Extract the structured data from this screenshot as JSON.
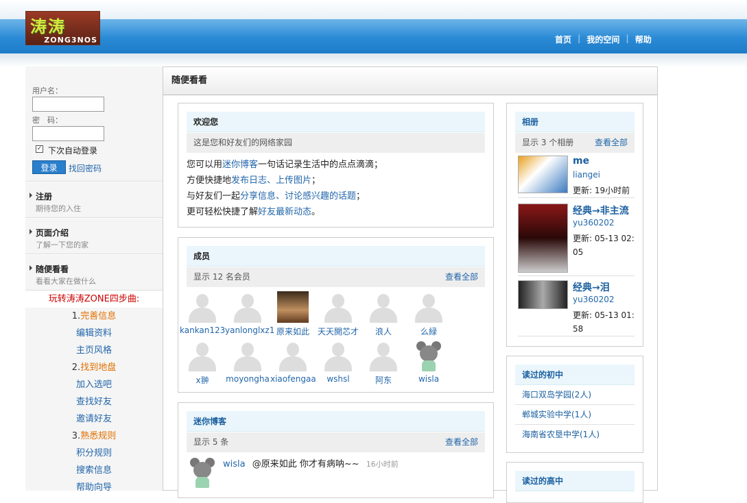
{
  "header": {
    "logo_big": "涛涛",
    "logo_small": "ZONG3NOS",
    "nav": [
      "首页",
      "我的空间",
      "帮助"
    ]
  },
  "login": {
    "username_label": "用户名：",
    "password_label": "密　码：",
    "remember_label": "下次自动登录",
    "remember_checked": true,
    "login_button": "登录",
    "forgot_link": "找回密码"
  },
  "sidebar": {
    "items": [
      {
        "title": "注册",
        "sub": "期待您的入住"
      },
      {
        "title": "页面介绍",
        "sub": "了解一下您的家"
      },
      {
        "title": "随便看看",
        "sub": "看看大家在做什么"
      }
    ],
    "steps_title": "玩转涛涛ZONE四步曲:",
    "steps": [
      {
        "num": "1.",
        "label": "完善信息",
        "kind": "heading"
      },
      {
        "label": "编辑资料",
        "kind": "link"
      },
      {
        "label": "主页风格",
        "kind": "link"
      },
      {
        "num": "2.",
        "label": "找到地盘",
        "kind": "heading"
      },
      {
        "label": "加入选吧",
        "kind": "link"
      },
      {
        "label": "查找好友",
        "kind": "link"
      },
      {
        "label": "邀请好友",
        "kind": "link"
      },
      {
        "num": "3.",
        "label": "熟悉规则",
        "kind": "heading"
      },
      {
        "label": "积分规则",
        "kind": "link"
      },
      {
        "label": "搜索信息",
        "kind": "link"
      },
      {
        "label": "帮助向导",
        "kind": "link"
      }
    ]
  },
  "main": {
    "title": "随便看看",
    "welcome": {
      "title": "欢迎您",
      "sub": "这是您和好友们的网络家园",
      "lines": [
        [
          "您可以用",
          "迷你博客",
          "一句话记录生活中的点点滴滴；"
        ],
        [
          "方便快捷地",
          "发布日志、上传图片",
          "；"
        ],
        [
          "与好友们一起",
          "分享信息、讨论感兴趣的话题",
          "；"
        ],
        [
          "更可轻松快捷了解",
          "好友最新动态",
          "。"
        ]
      ]
    },
    "members": {
      "title": "成员",
      "count": "显示 12 名会员",
      "view_all": "查看全部",
      "list": [
        {
          "name": "kankan123",
          "avatar": "silhouette"
        },
        {
          "name": "yanlonglxz1",
          "avatar": "silhouette"
        },
        {
          "name": "原来如此",
          "avatar": "photo"
        },
        {
          "name": "天天開芯才",
          "avatar": "silhouette"
        },
        {
          "name": "浪人",
          "avatar": "silhouette"
        },
        {
          "name": "么緑",
          "avatar": "silhouette"
        },
        {
          "name": "x翀",
          "avatar": "silhouette"
        },
        {
          "name": "moyongha",
          "avatar": "silhouette"
        },
        {
          "name": "xiaofengaa",
          "avatar": "silhouette"
        },
        {
          "name": "wshsl",
          "avatar": "silhouette"
        },
        {
          "name": "阿东",
          "avatar": "silhouette"
        },
        {
          "name": "wisla",
          "avatar": "mouse"
        }
      ]
    },
    "blog": {
      "title": "迷你博客",
      "count": "显示 5 条",
      "view_all": "查看全部",
      "post": {
        "user": "wisla",
        "text": "@原来如此 你才有病呐~~",
        "time": "16小时前"
      }
    }
  },
  "right": {
    "albums": {
      "title": "相册",
      "count": "显示 3 个相册",
      "view_all": "查看全部",
      "list": [
        {
          "title": "me",
          "user": "liangei",
          "updated": "更新: 19小时前"
        },
        {
          "title": "经典→非主流",
          "user": "yu360202",
          "updated": "更新: 05-13 02:05"
        },
        {
          "title": "经典→泪",
          "user": "yu360202",
          "updated": "更新: 05-13 01:58"
        }
      ]
    },
    "middle_school": {
      "title": "读过的初中",
      "list": [
        "海口双岛学园(2人)",
        "郸城实验中学(1人)",
        "海南省农垦中学(1人)"
      ]
    },
    "high_school": {
      "title": "读过的高中"
    }
  }
}
